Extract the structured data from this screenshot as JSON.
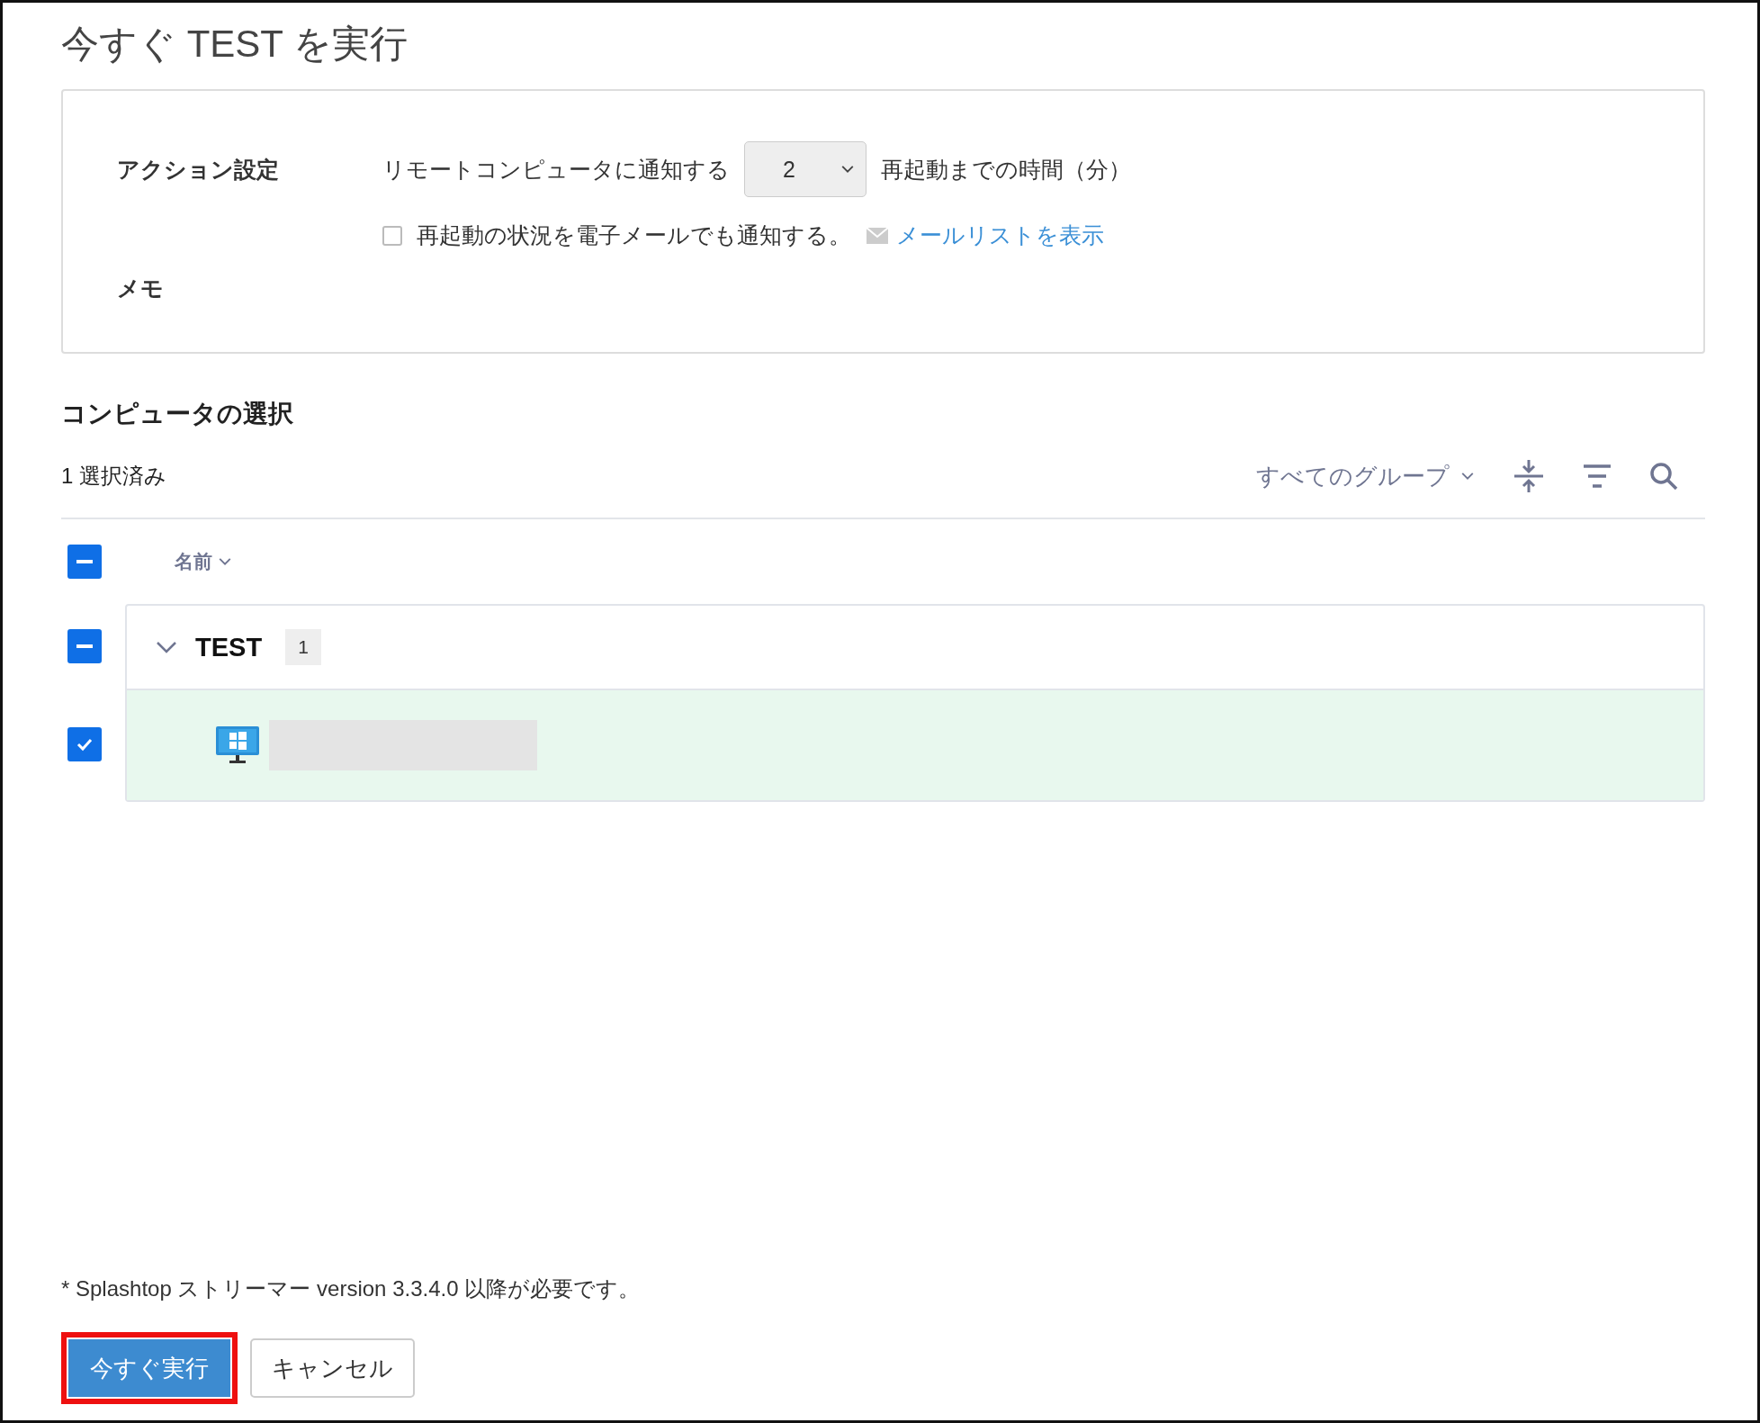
{
  "title": "今すぐ TEST を実行",
  "action_settings": {
    "label": "アクション設定",
    "notify_label": "リモートコンピュータに通知する",
    "minutes": {
      "value": "2"
    },
    "minutes_suffix": "再起動までの時間（分）",
    "email_checkbox": {
      "label": "再起動の状況を電子メールでも通知する。",
      "checked": false
    },
    "mail_list_link": "メールリストを表示",
    "memo_label": "メモ"
  },
  "computer_selection": {
    "heading": "コンピュータの選択",
    "selected_count": "1 選択済み",
    "group_filter": "すべてのグループ",
    "header": {
      "indeterminate": true,
      "name_column": "名前"
    },
    "groups": [
      {
        "name": "TEST",
        "count": "1",
        "indeterminate": true,
        "expanded": true,
        "computers": [
          {
            "kind": "redacted",
            "checked": true,
            "selected": true
          }
        ]
      }
    ]
  },
  "footnote": "* Splashtop ストリーマー version 3.3.4.0 以降が必要です。",
  "buttons": [
    {
      "label": "今すぐ実行",
      "kind": "primary",
      "highlighted": true
    },
    {
      "label": "キャンセル",
      "kind": "secondary",
      "highlighted": false
    }
  ]
}
